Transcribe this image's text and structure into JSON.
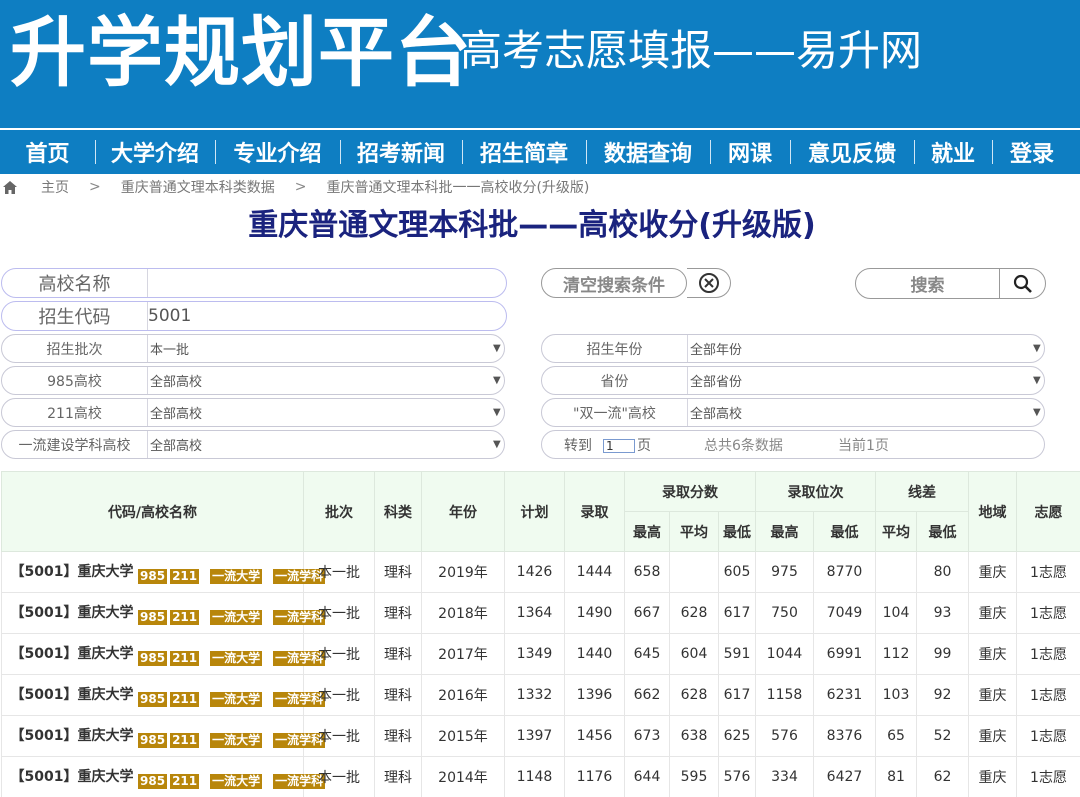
{
  "header": {
    "brand": "升学规划平台",
    "slogan": "高考志愿填报——易升网"
  },
  "nav": {
    "items": [
      "首页",
      "大学介绍",
      "专业介绍",
      "招考新闻",
      "招生简章",
      "数据查询",
      "网课",
      "意见反馈",
      "就业",
      "登录"
    ]
  },
  "breadcrumb": {
    "items": [
      "主页",
      "重庆普通文理本科类数据",
      "重庆普通文理本科批一一高校收分(升级版)"
    ],
    "separator": ">"
  },
  "page": {
    "title": "重庆普通文理本科批——高校收分(升级版)"
  },
  "search": {
    "school_name_label": "高校名称",
    "school_name_value": "",
    "code_label": "招生代码",
    "code_value": "5001",
    "clear_label": "清空搜索条件",
    "search_label": "搜索"
  },
  "filters": {
    "batch": {
      "label": "招生批次",
      "value": "本一批"
    },
    "year": {
      "label": "招生年份",
      "value": "全部年份"
    },
    "p985": {
      "label": "985高校",
      "value": "全部高校"
    },
    "province": {
      "label": "省份",
      "value": "全部省份"
    },
    "p211": {
      "label": "211高校",
      "value": "全部高校"
    },
    "double_first": {
      "label": "\"双一流\"高校",
      "value": "全部高校"
    },
    "first_class_discipline": {
      "label": "一流建设学科高校",
      "value": "全部高校"
    }
  },
  "pagination": {
    "goto_label": "转到",
    "page_input": "1",
    "page_unit": "页",
    "total": "总共6条数据",
    "current": "当前1页"
  },
  "table": {
    "headers": {
      "name": "代码/高校名称",
      "batch": "批次",
      "subject": "科类",
      "year": "年份",
      "plan": "计划",
      "admitted": "录取",
      "score_group": "录取分数",
      "rank_group": "录取位次",
      "diff_group": "线差",
      "region": "地域",
      "wish": "志愿",
      "sub": {
        "max": "最高",
        "avg": "平均",
        "min": "最低"
      }
    },
    "tags": [
      "985",
      "211",
      "一流大学",
      "一流学科"
    ],
    "rows": [
      {
        "name": "【5001】重庆大学",
        "batch": "本一批",
        "subject": "理科",
        "year": "2019年",
        "plan": "1426",
        "admitted": "1444",
        "score_max": "658",
        "score_avg": "",
        "score_min": "605",
        "rank_max": "975",
        "rank_min": "8770",
        "diff_avg": "",
        "diff_min": "80",
        "region": "重庆",
        "wish": "1志愿"
      },
      {
        "name": "【5001】重庆大学",
        "batch": "本一批",
        "subject": "理科",
        "year": "2018年",
        "plan": "1364",
        "admitted": "1490",
        "score_max": "667",
        "score_avg": "628",
        "score_min": "617",
        "rank_max": "750",
        "rank_min": "7049",
        "diff_avg": "104",
        "diff_min": "93",
        "region": "重庆",
        "wish": "1志愿"
      },
      {
        "name": "【5001】重庆大学",
        "batch": "本一批",
        "subject": "理科",
        "year": "2017年",
        "plan": "1349",
        "admitted": "1440",
        "score_max": "645",
        "score_avg": "604",
        "score_min": "591",
        "rank_max": "1044",
        "rank_min": "6991",
        "diff_avg": "112",
        "diff_min": "99",
        "region": "重庆",
        "wish": "1志愿"
      },
      {
        "name": "【5001】重庆大学",
        "batch": "本一批",
        "subject": "理科",
        "year": "2016年",
        "plan": "1332",
        "admitted": "1396",
        "score_max": "662",
        "score_avg": "628",
        "score_min": "617",
        "rank_max": "1158",
        "rank_min": "6231",
        "diff_avg": "103",
        "diff_min": "92",
        "region": "重庆",
        "wish": "1志愿"
      },
      {
        "name": "【5001】重庆大学",
        "batch": "本一批",
        "subject": "理科",
        "year": "2015年",
        "plan": "1397",
        "admitted": "1456",
        "score_max": "673",
        "score_avg": "638",
        "score_min": "625",
        "rank_max": "576",
        "rank_min": "8376",
        "diff_avg": "65",
        "diff_min": "52",
        "region": "重庆",
        "wish": "1志愿"
      },
      {
        "name": "【5001】重庆大学",
        "batch": "本一批",
        "subject": "理科",
        "year": "2014年",
        "plan": "1148",
        "admitted": "1176",
        "score_max": "644",
        "score_avg": "595",
        "score_min": "576",
        "rank_max": "334",
        "rank_min": "6427",
        "diff_avg": "81",
        "diff_min": "62",
        "region": "重庆",
        "wish": "1志愿"
      }
    ]
  }
}
